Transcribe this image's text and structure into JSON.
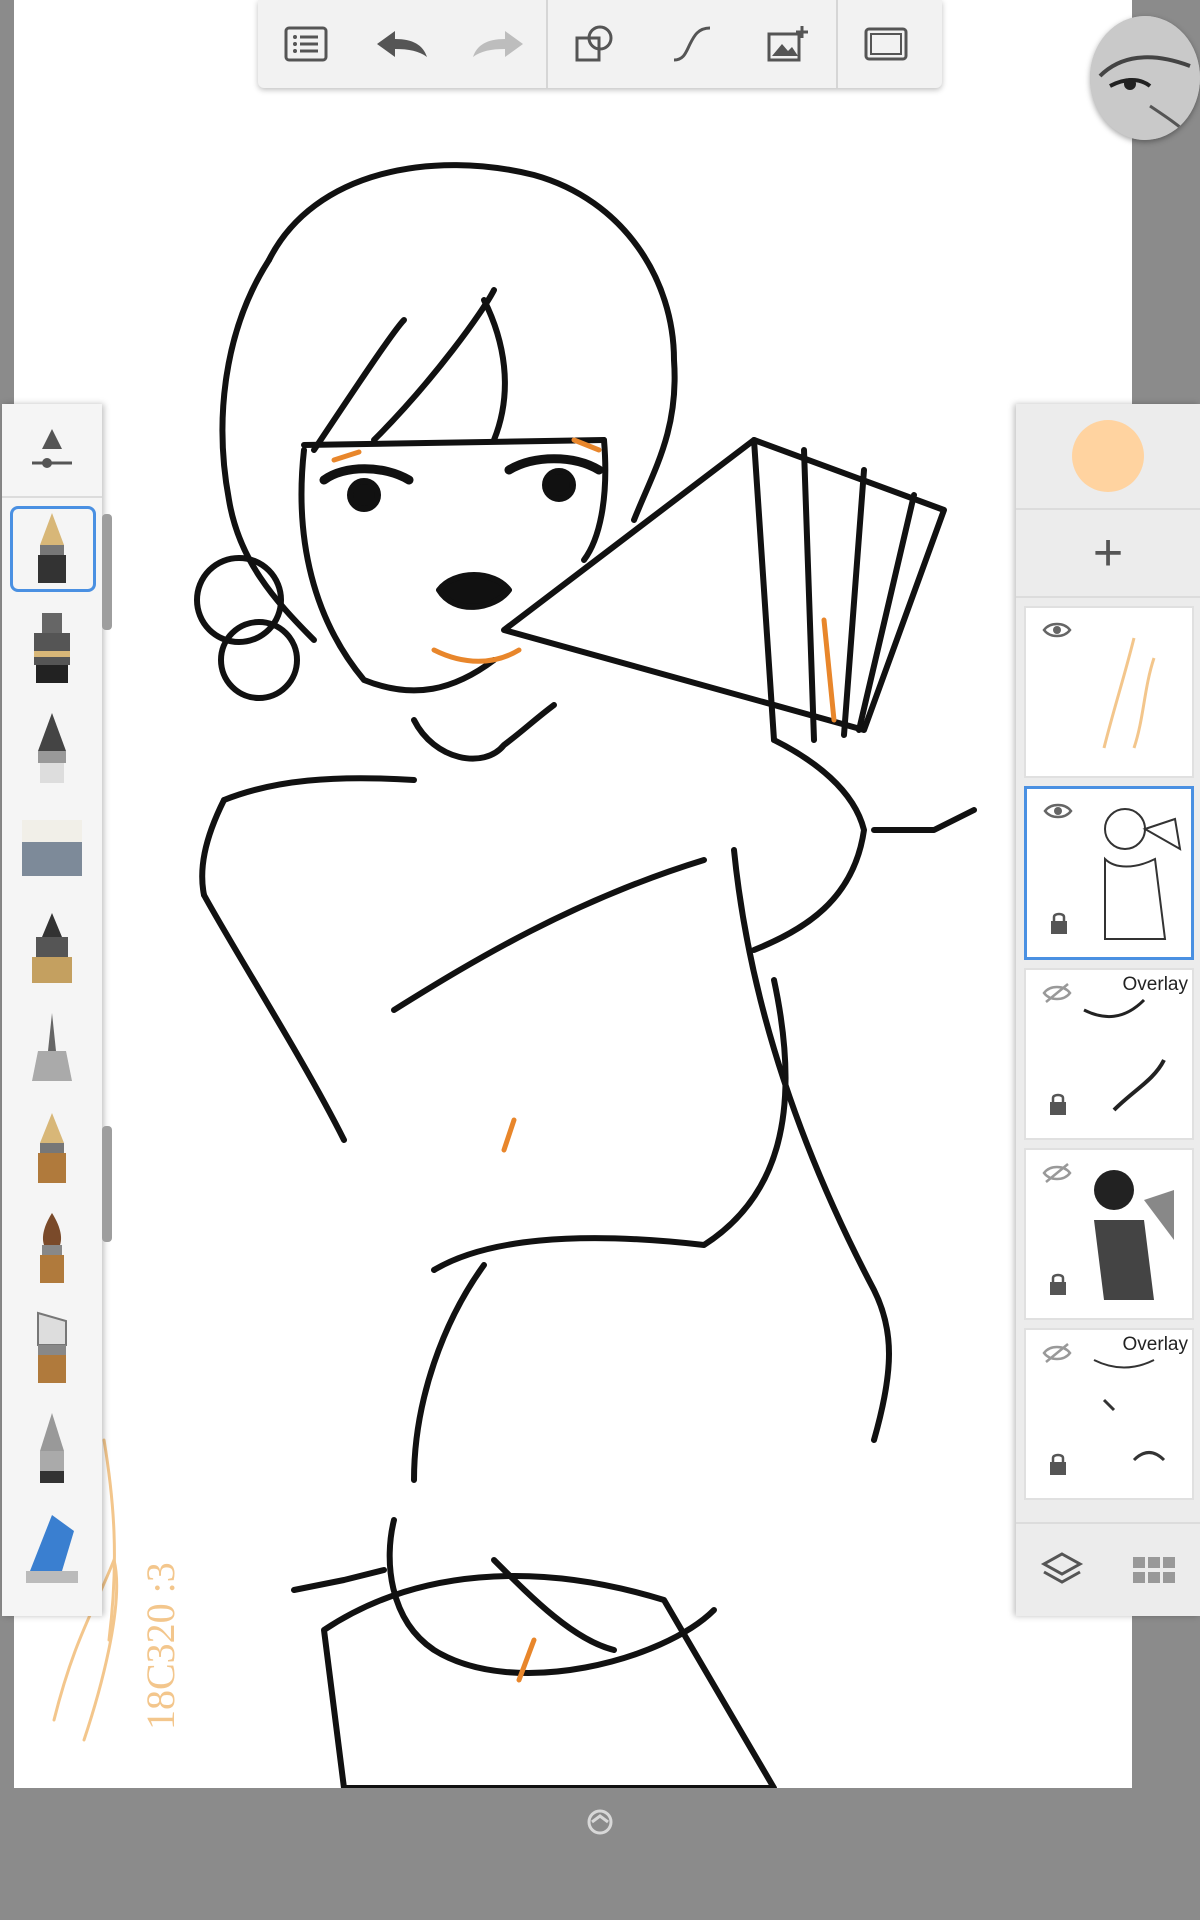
{
  "colors": {
    "background": "#8b8b8b",
    "canvas": "#ffffff",
    "current_color": "#ffd3a0",
    "selection": "#4a90e2",
    "accent_orange": "#e8862b"
  },
  "toolbar": {
    "buttons": [
      {
        "name": "layers-list-icon"
      },
      {
        "name": "undo-icon"
      },
      {
        "name": "redo-icon"
      },
      {
        "name": "shapes-icon"
      },
      {
        "name": "stroke-curve-icon"
      },
      {
        "name": "import-image-icon"
      },
      {
        "name": "fullscreen-icon"
      }
    ]
  },
  "brushes": {
    "selected_index": 0,
    "items": [
      "fountain-pen-icon",
      "ink-pen-icon",
      "calligraphy-nib-icon",
      "eraser-icon",
      "marker-icon",
      "fine-liner-icon",
      "gold-nib-icon",
      "paint-brush-icon",
      "flat-brush-icon",
      "pencil-icon",
      "airbrush-icon"
    ]
  },
  "layers": {
    "add_label": "+",
    "items": [
      {
        "visible": true,
        "locked": false,
        "blend": "",
        "selected": false,
        "thumb": "signature"
      },
      {
        "visible": true,
        "locked": true,
        "blend": "",
        "selected": true,
        "thumb": "lineart"
      },
      {
        "visible": false,
        "locked": true,
        "blend": "Overlay",
        "selected": false,
        "thumb": "shading"
      },
      {
        "visible": false,
        "locked": true,
        "blend": "",
        "selected": false,
        "thumb": "reference"
      },
      {
        "visible": false,
        "locked": true,
        "blend": "Overlay",
        "selected": false,
        "thumb": "shading2"
      }
    ]
  },
  "canvas": {
    "signature_text": "18C320 :3"
  }
}
